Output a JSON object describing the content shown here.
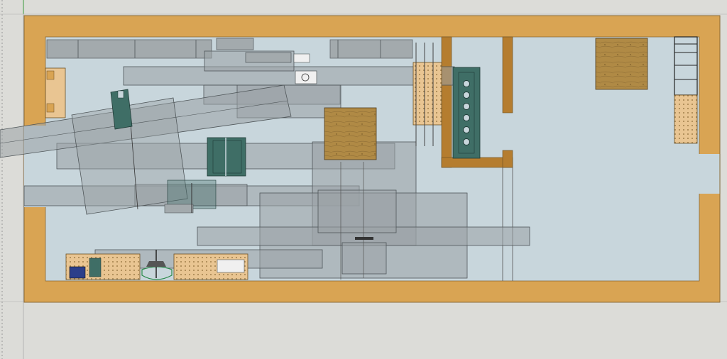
{
  "colors": {
    "background": "#dcdcd8",
    "wall": "#d9a453",
    "wall_edge": "#8a6a35",
    "floor": "#c8d6dc",
    "table_gray": "#9ba3a6",
    "machine_green": "#3f6e66",
    "plywood": "#b08a45",
    "pegboard": "#e9c592",
    "interior_wall": "#b57d2f"
  },
  "icons": {
    "lathe": "lathe-icon",
    "table_saw": "table-saw-icon",
    "bandsaw": "bandsaw-icon",
    "drill_press": "drill-press-icon",
    "dust_collector": "dust-collector-icon",
    "ladder": "ladder-icon"
  }
}
